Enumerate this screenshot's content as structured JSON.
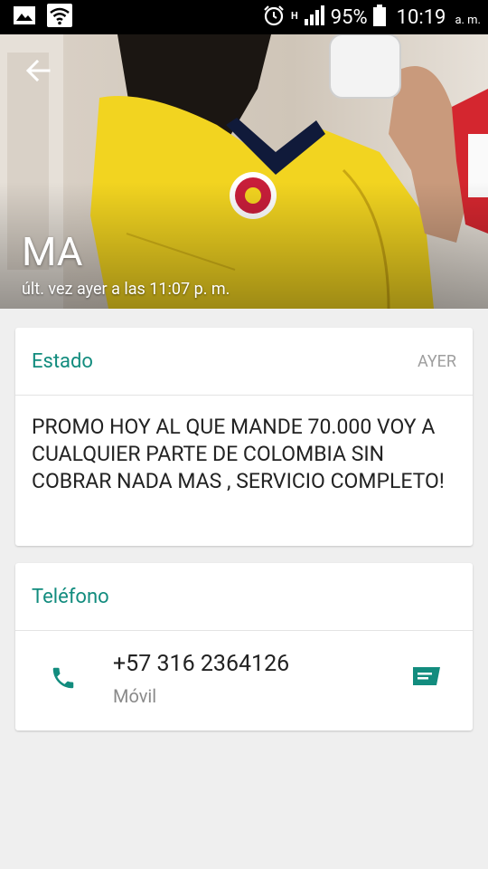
{
  "status_bar": {
    "battery": "95%",
    "time": "10:19",
    "ampm": "a. m.",
    "network": "H"
  },
  "header": {
    "name": "MA",
    "last_seen": "últ. vez ayer a las 11:07 p. m."
  },
  "status_card": {
    "title": "Estado",
    "date": "AYER",
    "text": "PROMO HOY AL QUE MANDE 70.000 VOY A CUALQUIER PARTE DE COLOMBIA SIN COBRAR NADA MAS , SERVICIO COMPLETO!"
  },
  "phone_card": {
    "title": "Teléfono",
    "number": "+57 316 2364126",
    "type": "Móvil"
  },
  "colors": {
    "accent": "#128c7e",
    "status_bar": "#000000",
    "background": "#efefef"
  },
  "icons": {
    "back": "arrow-left-icon",
    "phone": "phone-icon",
    "message": "message-icon",
    "gallery": "image-icon",
    "wifi": "wifi-icon",
    "alarm": "alarm-icon",
    "signal": "signal-icon",
    "battery": "battery-icon"
  }
}
